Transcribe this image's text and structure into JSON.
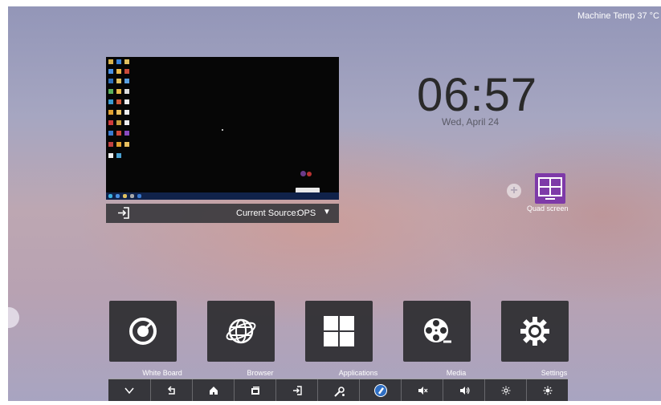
{
  "status": {
    "machine_temp": "Machine Temp 37 °C"
  },
  "source_preview": {
    "current_source_label": "Current Source:",
    "current_source_value": "OPS",
    "arrow_glyph": "▼"
  },
  "clock": {
    "time": "06:57",
    "date": "Wed, April 24"
  },
  "widgets": {
    "add_glyph": "+",
    "quad_screen_label": "Quad screen"
  },
  "apps": [
    {
      "id": "white-board",
      "label": "White Board",
      "icon": "pen-circle-icon"
    },
    {
      "id": "browser",
      "label": "Browser",
      "icon": "globe-icon"
    },
    {
      "id": "applications",
      "label": "Applications",
      "icon": "grid-icon"
    },
    {
      "id": "media",
      "label": "Media",
      "icon": "film-reel-icon"
    },
    {
      "id": "settings",
      "label": "Settings",
      "icon": "gear-icon"
    }
  ],
  "dock": [
    {
      "id": "collapse",
      "icon": "chevron-down-icon"
    },
    {
      "id": "back",
      "icon": "back-arrow-icon"
    },
    {
      "id": "home",
      "icon": "home-icon"
    },
    {
      "id": "windows",
      "icon": "window-icon"
    },
    {
      "id": "source",
      "icon": "input-source-icon"
    },
    {
      "id": "tools",
      "icon": "tools-icon"
    },
    {
      "id": "annotate",
      "icon": "pen-icon"
    },
    {
      "id": "volume-down",
      "icon": "volume-down-icon"
    },
    {
      "id": "volume-up",
      "icon": "volume-up-icon"
    },
    {
      "id": "brightness-down",
      "icon": "brightness-down-icon"
    },
    {
      "id": "brightness-up",
      "icon": "brightness-up-icon"
    }
  ],
  "colors": {
    "accent_purple": "#7e3aa8",
    "annotate_blue": "#2f6fc4",
    "tile_bg": "#2d2d30"
  }
}
